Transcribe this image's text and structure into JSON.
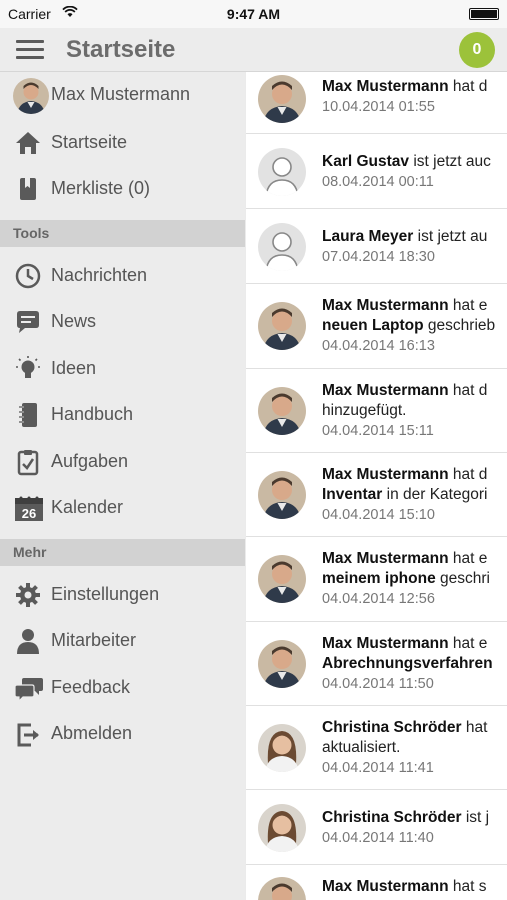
{
  "status": {
    "carrier": "Carrier",
    "time": "9:47 AM"
  },
  "nav": {
    "title": "Startseite",
    "badge": "0"
  },
  "sidebar": {
    "user": "Max Mustermann",
    "items_top": [
      {
        "label": "Startseite",
        "icon": "home-icon"
      },
      {
        "label": "Merkliste (0)",
        "icon": "bookmark-icon"
      }
    ],
    "section_tools": "Tools",
    "items_tools": [
      {
        "label": "Nachrichten",
        "icon": "clock-icon"
      },
      {
        "label": "News",
        "icon": "speech-bubble-icon"
      },
      {
        "label": "Ideen",
        "icon": "lightbulb-icon"
      },
      {
        "label": "Handbuch",
        "icon": "notebook-icon"
      },
      {
        "label": "Aufgaben",
        "icon": "clipboard-check-icon"
      },
      {
        "label": "Kalender",
        "icon": "calendar-icon",
        "day": "26"
      }
    ],
    "section_more": "Mehr",
    "items_more": [
      {
        "label": "Einstellungen",
        "icon": "gear-icon"
      },
      {
        "label": "Mitarbeiter",
        "icon": "person-icon"
      },
      {
        "label": "Feedback",
        "icon": "chat-bubbles-icon"
      },
      {
        "label": "Abmelden",
        "icon": "logout-icon"
      }
    ]
  },
  "feed": [
    {
      "name": "Max Mustermann",
      "rest": " hat d",
      "line2": "",
      "line2_rest": "",
      "date": "10.04.2014 01:55",
      "avatar": "male"
    },
    {
      "name": "Karl Gustav",
      "rest": " ist jetzt auc",
      "line2": "",
      "line2_rest": "",
      "date": "08.04.2014 00:11",
      "avatar": "placeholder"
    },
    {
      "name": "Laura Meyer",
      "rest": " ist jetzt au",
      "line2": "",
      "line2_rest": "",
      "date": "07.04.2014 18:30",
      "avatar": "placeholder"
    },
    {
      "name": "Max Mustermann",
      "rest": " hat e",
      "line2": "neuen Laptop",
      "line2_rest": " geschrieb",
      "date": "04.04.2014 16:13",
      "avatar": "male"
    },
    {
      "name": "Max Mustermann",
      "rest": " hat d",
      "line2": "",
      "line2_rest": "hinzugefügt.",
      "date": "04.04.2014 15:11",
      "avatar": "male"
    },
    {
      "name": "Max Mustermann",
      "rest": " hat d",
      "line2": "Inventar",
      "line2_rest": " in der Kategori",
      "date": "04.04.2014 15:10",
      "avatar": "male"
    },
    {
      "name": "Max Mustermann",
      "rest": " hat e",
      "line2": "meinem iphone",
      "line2_rest": " geschri",
      "date": "04.04.2014 12:56",
      "avatar": "male"
    },
    {
      "name": "Max Mustermann",
      "rest": " hat e",
      "line2": "Abrechnungsverfahren",
      "line2_rest": "",
      "date": "04.04.2014 11:50",
      "avatar": "male"
    },
    {
      "name": "Christina Schröder",
      "rest": " hat",
      "line2": "",
      "line2_rest": "aktualisiert.",
      "date": "04.04.2014 11:41",
      "avatar": "female"
    },
    {
      "name": "Christina Schröder",
      "rest": " ist j",
      "line2": "",
      "line2_rest": "",
      "date": "04.04.2014 11:40",
      "avatar": "female"
    },
    {
      "name": "Max Mustermann",
      "rest": " hat s",
      "line2": "",
      "line2_rest": "",
      "date": "",
      "avatar": "male"
    }
  ]
}
